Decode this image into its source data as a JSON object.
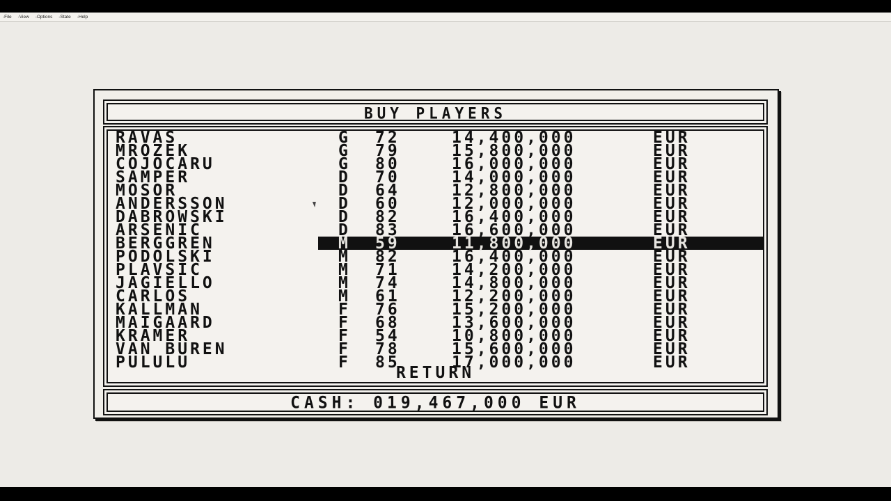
{
  "menu": [
    "-File",
    "-View",
    "-Options",
    "-State",
    "-Help"
  ],
  "game": {
    "title": "BUY PLAYERS",
    "players": [
      {
        "name": "RAVAS",
        "pos": "G",
        "rating": "72",
        "fee": "14,400,000",
        "currency": "EUR"
      },
      {
        "name": "MROZEK",
        "pos": "G",
        "rating": "79",
        "fee": "15,800,000",
        "currency": "EUR"
      },
      {
        "name": "COJOCARU",
        "pos": "G",
        "rating": "80",
        "fee": "16,000,000",
        "currency": "EUR"
      },
      {
        "name": "SAMPER",
        "pos": "D",
        "rating": "70",
        "fee": "14,000,000",
        "currency": "EUR"
      },
      {
        "name": "MOSOR",
        "pos": "D",
        "rating": "64",
        "fee": "12,800,000",
        "currency": "EUR"
      },
      {
        "name": "ANDERSSON",
        "pos": "D",
        "rating": "60",
        "fee": "12,000,000",
        "currency": "EUR"
      },
      {
        "name": "DABROWSKI",
        "pos": "D",
        "rating": "82",
        "fee": "16,400,000",
        "currency": "EUR"
      },
      {
        "name": "ARSENIC",
        "pos": "D",
        "rating": "83",
        "fee": "16,600,000",
        "currency": "EUR"
      },
      {
        "name": "BERGGREN",
        "pos": "M",
        "rating": "59",
        "fee": "11,800,000",
        "currency": "EUR",
        "selected": true
      },
      {
        "name": "PODOLSKI",
        "pos": "M",
        "rating": "82",
        "fee": "16,400,000",
        "currency": "EUR"
      },
      {
        "name": "PLAVSIC",
        "pos": "M",
        "rating": "71",
        "fee": "14,200,000",
        "currency": "EUR"
      },
      {
        "name": "JAGIELLO",
        "pos": "M",
        "rating": "74",
        "fee": "14,800,000",
        "currency": "EUR"
      },
      {
        "name": "CARLOS",
        "pos": "M",
        "rating": "61",
        "fee": "12,200,000",
        "currency": "EUR"
      },
      {
        "name": "KALLMAN",
        "pos": "F",
        "rating": "76",
        "fee": "15,200,000",
        "currency": "EUR"
      },
      {
        "name": "MAIGAARD",
        "pos": "F",
        "rating": "68",
        "fee": "13,600,000",
        "currency": "EUR"
      },
      {
        "name": "KRAMER",
        "pos": "F",
        "rating": "54",
        "fee": "10,800,000",
        "currency": "EUR"
      },
      {
        "name": "VAN BUREN",
        "pos": "F",
        "rating": "78",
        "fee": "15,600,000",
        "currency": "EUR"
      },
      {
        "name": "PULULU",
        "pos": "F",
        "rating": "85",
        "fee": "17,000,000",
        "currency": "EUR"
      }
    ],
    "return_label": "RETURN",
    "cash_label": "CASH: 019,467,000 EUR"
  },
  "colors": {
    "ink": "#111111",
    "paper": "#f4f2ee",
    "desktop": "#edebe7"
  }
}
